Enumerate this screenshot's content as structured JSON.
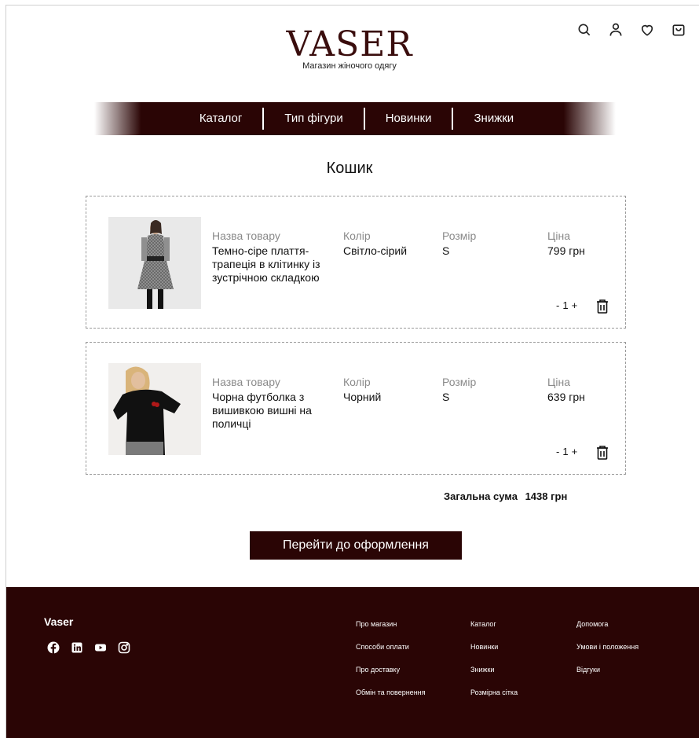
{
  "header": {
    "brand": "VASER",
    "subtitle": "Магазин жіночого одягу",
    "icons": [
      "search-icon",
      "user-icon",
      "heart-icon",
      "cart-icon"
    ]
  },
  "nav": [
    "Каталог",
    "Тип фігури",
    "Новинки",
    "Знижки"
  ],
  "page_title": "Кошик",
  "labels": {
    "name": "Назва товару",
    "color": "Колір",
    "size": "Розмір",
    "price": "Ціна"
  },
  "items": [
    {
      "name": "Темно-сіре плаття-трапеція в клітинку із зустрічною складкою",
      "color": "Світло-сірий",
      "size": "S",
      "price": "799 грн",
      "qty_minus": "-",
      "qty": "1",
      "qty_plus": "+"
    },
    {
      "name": "Чорна футболка з вишивкою вишні на поличці",
      "color": "Чорний",
      "size": "S",
      "price": "639 грн",
      "qty_minus": "-",
      "qty": "1",
      "qty_plus": "+"
    }
  ],
  "total": {
    "label": "Загальна сума",
    "amount": "1438 грн"
  },
  "checkout_label": "Перейти до оформлення",
  "footer": {
    "brand": "Vaser",
    "social": [
      "facebook-icon",
      "linkedin-icon",
      "youtube-icon",
      "instagram-icon"
    ],
    "col1": [
      "Про магазин",
      "Способи оплати",
      "Про доставку",
      "Обмін та повернення"
    ],
    "col2": [
      "Каталог",
      "Новинки",
      "Знижки",
      "Розмірна сітка"
    ],
    "col3": [
      "Допомога",
      "Умови і положення",
      "Відгуки"
    ]
  },
  "colors": {
    "brand_dark": "#2a0505",
    "logo": "#3a0d0d"
  }
}
